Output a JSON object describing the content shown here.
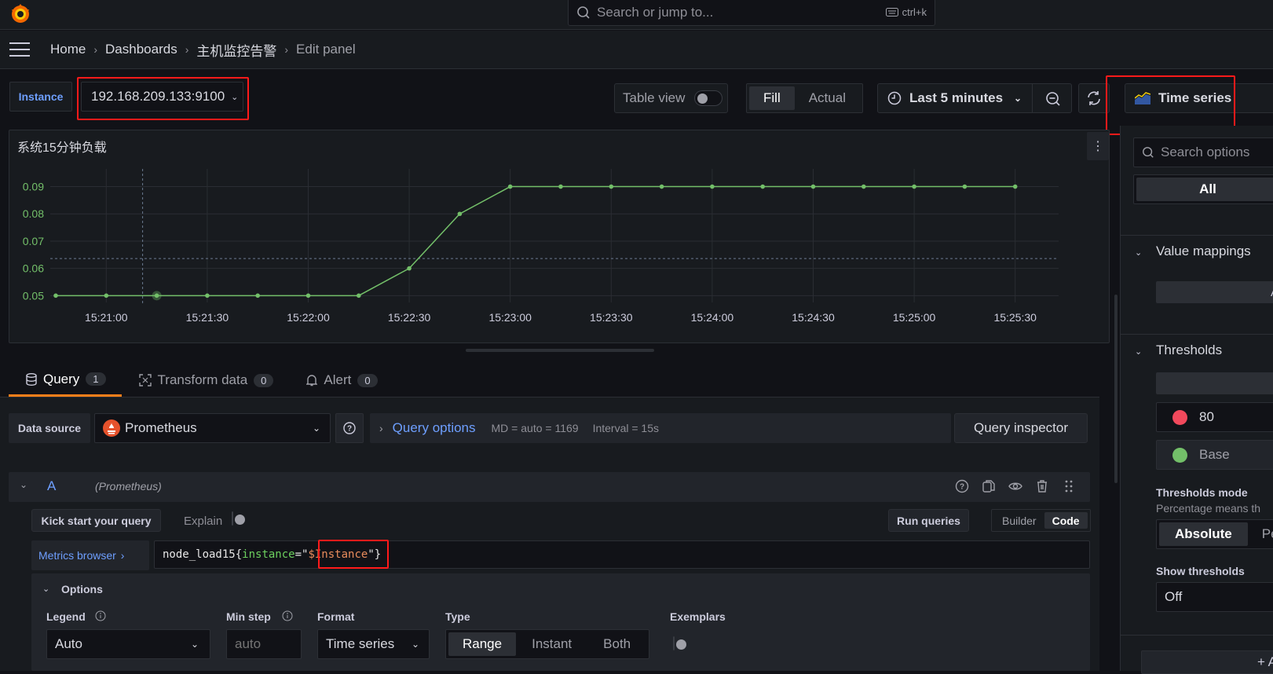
{
  "topbar": {
    "search_placeholder": "Search or jump to...",
    "shortcut": "ctrl+k"
  },
  "breadcrumb": [
    "Home",
    "Dashboards",
    "主机监控告警",
    "Edit panel"
  ],
  "variables": {
    "label": "Instance",
    "value": "192.168.209.133:9100"
  },
  "toolbar": {
    "table_view": "Table view",
    "table_view_on": false,
    "fill": "Fill",
    "actual": "Actual",
    "time_range": "Last 5 minutes",
    "visualization": "Time series"
  },
  "panel": {
    "title": "系统15分钟负载"
  },
  "chart_data": {
    "type": "line",
    "title": "系统15分钟负载",
    "x": [
      "15:20:45",
      "15:21:00",
      "15:21:15",
      "15:21:30",
      "15:21:45",
      "15:22:00",
      "15:22:15",
      "15:22:30",
      "15:22:45",
      "15:23:00",
      "15:23:15",
      "15:23:30",
      "15:23:45",
      "15:24:00",
      "15:24:15",
      "15:24:30",
      "15:24:45",
      "15:25:00",
      "15:25:15",
      "15:25:30"
    ],
    "series": [
      {
        "name": "node_load15",
        "color": "#73bf69",
        "values": [
          0.05,
          0.05,
          0.05,
          0.05,
          0.05,
          0.05,
          0.05,
          0.06,
          0.08,
          0.09,
          0.09,
          0.09,
          0.09,
          0.09,
          0.09,
          0.09,
          0.09,
          0.09,
          0.09,
          0.09
        ]
      }
    ],
    "x_ticks": [
      "15:21:00",
      "15:21:30",
      "15:22:00",
      "15:22:30",
      "15:23:00",
      "15:23:30",
      "15:24:00",
      "15:24:30",
      "15:25:00",
      "15:25:30"
    ],
    "y_ticks": [
      "0.05",
      "0.06",
      "0.07",
      "0.08",
      "0.09"
    ],
    "ylim": [
      0.0475,
      0.0965
    ],
    "xlabel": "",
    "ylabel": "",
    "grid": true,
    "cursor_value": 0.0636
  },
  "tabs": [
    {
      "label": "Query",
      "count": "1"
    },
    {
      "label": "Transform data",
      "count": "0"
    },
    {
      "label": "Alert",
      "count": "0"
    }
  ],
  "query": {
    "datasource_label": "Data source",
    "datasource": "Prometheus",
    "query_options": "Query options",
    "md": "MD = auto = 1169",
    "interval": "Interval = 15s",
    "inspector": "Query inspector",
    "ref_id": "A",
    "ref_source": "(Prometheus)",
    "kick_start": "Kick start your query",
    "explain": "Explain",
    "run_queries": "Run queries",
    "builder": "Builder",
    "code": "Code",
    "metrics_browser": "Metrics browser",
    "expr_metric": "node_load15{",
    "expr_label": "instance",
    "expr_eq": "=\"",
    "expr_var": "$Instance",
    "expr_end": "\"}",
    "options_title": "Options",
    "legend_label": "Legend",
    "legend_value": "Auto",
    "minstep_label": "Min step",
    "minstep_placeholder": "auto",
    "format_label": "Format",
    "format_value": "Time series",
    "type_label": "Type",
    "type_options": [
      "Range",
      "Instant",
      "Both"
    ],
    "exemplars_label": "Exemplars"
  },
  "options_pane": {
    "search_placeholder": "Search options",
    "all": "All",
    "value_mappings": "Value mappings",
    "add_mapping_partial": "A",
    "thresholds": "Thresholds",
    "threshold_items": [
      {
        "value": "80",
        "color": "#f2495c"
      },
      {
        "value": "Base",
        "color": "#73bf69"
      }
    ],
    "thresholds_mode": "Thresholds mode",
    "thresholds_mode_desc": "Percentage means th",
    "mode_absolute": "Absolute",
    "mode_percentage_partial": "Pe",
    "show_thresholds": "Show thresholds",
    "show_thresholds_value": "Off",
    "add_partial": "+ A"
  }
}
